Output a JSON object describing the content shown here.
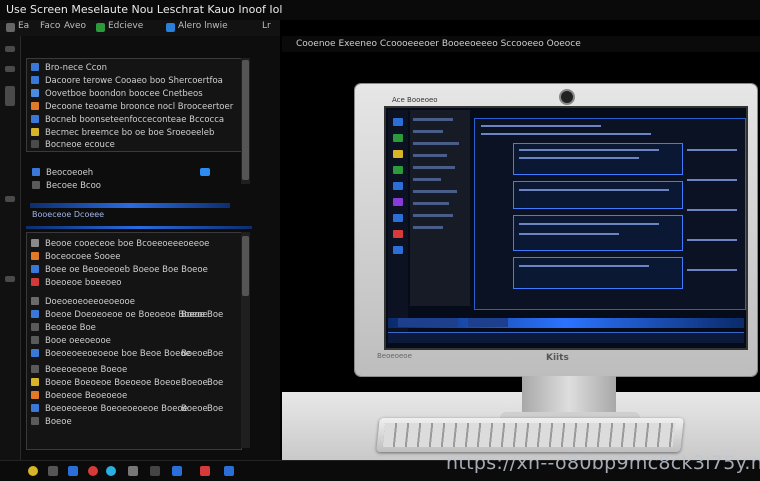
{
  "window": {
    "title": "Use Screen  Meselaute  Nou  Leschrat  Kauo  Inoof  Iol",
    "menu": [
      "Ea",
      "Faco",
      "Aveo",
      "Edcieve",
      "Alero lnwie",
      "Lr"
    ]
  },
  "left_panel": {
    "top_list": [
      {
        "label": "Bro-nece Ccon",
        "value": "",
        "color": "#3a78d8"
      },
      {
        "label": "Dacoore terowe Cooaeo boo Shercoertfoa",
        "value": "",
        "color": "#3a78d8"
      },
      {
        "label": "Oovetboe boondon boocee Cnetbeos",
        "value": "",
        "color": "#4a8ae0"
      },
      {
        "label": "Decoone teoame broonce nocl Brooceertoer",
        "value": "",
        "color": "#e07a26"
      },
      {
        "label": "Bocneb boonseteenfocceconteae Bccocca",
        "value": "",
        "color": "#3a78d8"
      },
      {
        "label": "Becmec breemce bo oe boe Sroeoeeleb",
        "value": "",
        "color": "#d8b428"
      },
      {
        "label": "Bocneoe ecouce",
        "value": "",
        "color": "#4a4a4a"
      }
    ],
    "mid_items": [
      {
        "label": "Beocoeoeh",
        "color": "#3a78d8"
      },
      {
        "label": "Becoee Bcoo",
        "color": "#5a5a5a"
      }
    ],
    "section_header": "Booeceoe Dcoeee",
    "bottom_list": [
      {
        "label": "Beooe cooeceoe boe Bcoeeoeeeoeeoe",
        "value": "",
        "v2": "",
        "color": "#8a8a8a"
      },
      {
        "label": "Boceocoee Sooee",
        "value": "",
        "v2": "",
        "color": "#e07a26"
      },
      {
        "label": "Boee oe Beoeoeoeb Boeoe Boe Boeoe",
        "value": "",
        "v2": "",
        "color": "#3a78d8"
      },
      {
        "label": "Boeoeoe boeeoeo",
        "value": "",
        "v2": "",
        "color": "#d03a3a"
      },
      {
        "label": "Doeoeoeoeeoeoeooe",
        "value": "",
        "v2": "",
        "color": "#6a6a6a"
      },
      {
        "label": "Boeoe Doeoeoeoe oe Boeoeoe Boeoe",
        "value": "Boeoe",
        "v2": "Boe",
        "color": "#3a78d8"
      },
      {
        "label": "Beoeoe Boe",
        "value": "",
        "v2": "",
        "color": "#5a5a5a"
      },
      {
        "label": "Booe oeeoeooe",
        "value": "",
        "v2": "",
        "color": "#5a5a5a"
      },
      {
        "label": "Boeoeoeeoeoeoe boe Beoe Boeoe",
        "value": "Boeoe",
        "v2": "Boe",
        "color": "#3a78d8"
      },
      {
        "label": "Boeeoeoeoe Boeoe",
        "value": "",
        "v2": "",
        "color": "#5a5a5a"
      },
      {
        "label": "Boeoe Boeoeoe Boeoeoe Boeoe",
        "value": "Boeoe",
        "v2": "Boe",
        "color": "#d8b428"
      },
      {
        "label": "Boeoeoe Beoeoeoe",
        "value": "",
        "v2": "",
        "color": "#e07a26"
      },
      {
        "label": "Boeoeoeeoe Boeoeoeoeoe Boeoe",
        "value": "Boeoe",
        "v2": "Boe",
        "color": "#3a78d8"
      },
      {
        "label": "Boeoe",
        "value": "",
        "v2": "",
        "color": "#5a5a5a"
      }
    ]
  },
  "right_panel": {
    "title": "Cooenoe Exeeneo Ccoooeeeoer Booeeoeeeo Sccooeeo Ooeoce",
    "monitor_brand": "Kiits",
    "monitor_label": "Beoeoeoe",
    "screen_app_title": "Ace Booeoeo"
  },
  "taskbar": {
    "icons": [
      "start-icon",
      "folder-icon",
      "browser-icon",
      "media-icon",
      "chat-icon",
      "terminal-icon",
      "settings-icon",
      "store-icon",
      "mail-icon",
      "window-icon"
    ]
  },
  "watermark": "https://xn--o80bp9mc8ck3l75y.net"
}
